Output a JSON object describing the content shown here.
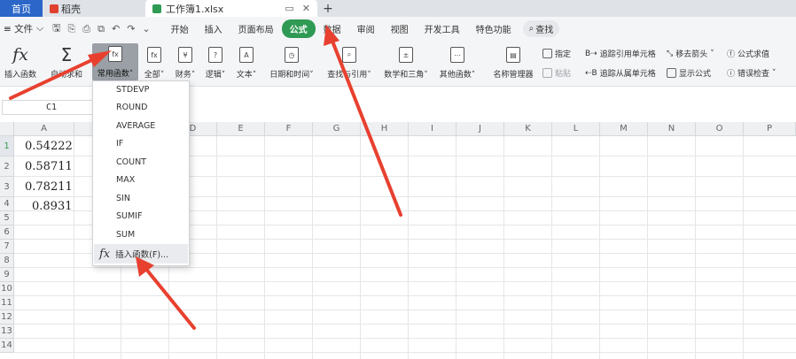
{
  "tabs": {
    "home": "首页",
    "daoke": "稻壳",
    "file": "工作簿1.xlsx",
    "add": "+"
  },
  "menubar": {
    "file_menu": "≡ 文件",
    "tabs": [
      "开始",
      "插入",
      "页面布局",
      "公式",
      "数据",
      "审阅",
      "视图",
      "开发工具",
      "特色功能"
    ],
    "active_tab": "公式",
    "search": "查找"
  },
  "ribbon": {
    "insert_function": "插入函数",
    "autosum": "自动求和",
    "common_functions": "常用函数",
    "all": "全部",
    "finance": "财务",
    "logic": "逻辑",
    "text": "文本",
    "datetime": "日期和时间",
    "lookup": "查找与引用",
    "math": "数学和三角",
    "other": "其他函数",
    "name_manager": "名称管理器",
    "specify": "指定",
    "paste": "粘贴",
    "trace_precedents": "追踪引用单元格",
    "trace_dependents": "追踪从属单元格",
    "remove_arrows": "移去箭头",
    "show_formulas": "显示公式",
    "evaluate": "公式求值",
    "error_check": "错误检查"
  },
  "namebox": "C1",
  "columns": [
    "A",
    "B",
    "C",
    "D",
    "E",
    "F",
    "G",
    "H",
    "I",
    "J",
    "K",
    "L",
    "M",
    "N",
    "O",
    "P"
  ],
  "rows": [
    "1",
    "2",
    "3",
    "4",
    "5",
    "6",
    "7",
    "8",
    "9",
    "10",
    "11",
    "12",
    "13",
    "14"
  ],
  "cells": [
    "0.54222",
    "0.58711",
    "0.78211",
    "0.8931"
  ],
  "dropdown": {
    "items": [
      "STDEVP",
      "ROUND",
      "AVERAGE",
      "IF",
      "COUNT",
      "MAX",
      "SIN",
      "SUMIF",
      "SUM"
    ],
    "footer": "插入函数(F)..."
  },
  "colors": {
    "accent_green": "#2f9a54",
    "home_blue": "#2b66c8",
    "arrow_red": "#e8402f"
  }
}
